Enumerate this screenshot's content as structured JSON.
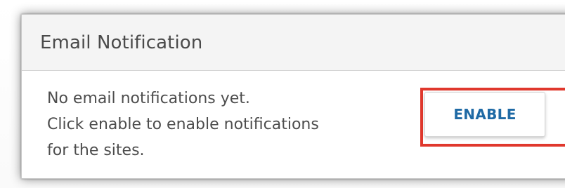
{
  "panel": {
    "title": "Email Notification"
  },
  "message": {
    "lines": [
      "No email notifications yet.",
      "Click enable to enable notifications",
      "for the sites."
    ]
  },
  "actions": {
    "enable_label": "ENABLE"
  },
  "colors": {
    "highlight": "#e0382d",
    "button_text": "#1f6aa5",
    "header_bg": "#f4f4f4"
  }
}
